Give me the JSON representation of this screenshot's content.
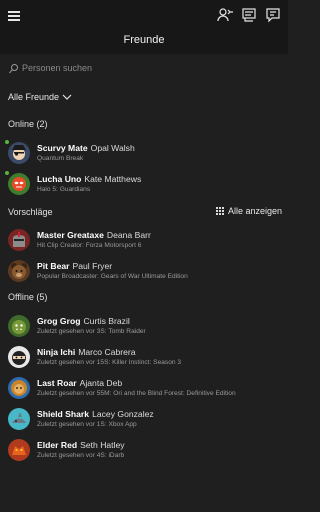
{
  "header": {
    "title": "Freunde"
  },
  "search": {
    "placeholder": "Personen suchen"
  },
  "filter": {
    "label": "Alle Freunde"
  },
  "sections": {
    "online": "Online (2)",
    "suggestions": "Vorschläge",
    "see_all": "Alle anzeigen",
    "offline": "Offline (5)"
  },
  "online": [
    {
      "gamertag": "Scurvy Mate",
      "name": "Opal Walsh",
      "status": "Quantum Break",
      "avatar": "pirate-avatar",
      "color": "#3b4a66"
    },
    {
      "gamertag": "Lucha Uno",
      "name": "Kate Matthews",
      "status": "Halo 5: Guardians",
      "avatar": "luchador-avatar",
      "color": "#3f7d2e"
    }
  ],
  "suggestions": [
    {
      "gamertag": "Master Greataxe",
      "name": "Deana Barr",
      "status": "Hit Clip Creator: Forza Motorsport 6",
      "avatar": "knight-avatar",
      "color": "#7a2424"
    },
    {
      "gamertag": "Pit Bear",
      "name": "Paul Fryer",
      "status": "Popular Broadcaster: Gears of War Ultimate Edition",
      "avatar": "bear-avatar",
      "color": "#5b3a22"
    }
  ],
  "offline": [
    {
      "gamertag": "Grog Grog",
      "name": "Curtis Brazil",
      "status": "Zuletzt gesehen vor 3S: Tomb Raider",
      "avatar": "orc-avatar",
      "color": "#3f6a2a"
    },
    {
      "gamertag": "Ninja Ichi",
      "name": "Marco Cabrera",
      "status": "Zuletzt gesehen vor 15S: Killer Instinct: Season 3",
      "avatar": "ninja-avatar",
      "color": "#e8e8e8"
    },
    {
      "gamertag": "Last Roar",
      "name": "Ajanta Deb",
      "status": "Zuletzt gesehen vor 55M: Ori and the Blind Forest: Definitive Edition",
      "avatar": "lion-avatar",
      "color": "#2d6bb0"
    },
    {
      "gamertag": "Shield Shark",
      "name": "Lacey Gonzalez",
      "status": "Zuletzt gesehen vor 1S: Xbox App",
      "avatar": "shark-avatar",
      "color": "#47b8c8"
    },
    {
      "gamertag": "Elder Red",
      "name": "Seth Hatley",
      "status": "Zuletzt gesehen vor 4S: iDarb",
      "avatar": "dragon-avatar",
      "color": "#b03a1e"
    }
  ],
  "colors": {
    "background": "#1f1f1f",
    "header": "#171717",
    "online_indicator": "#57b53e"
  }
}
